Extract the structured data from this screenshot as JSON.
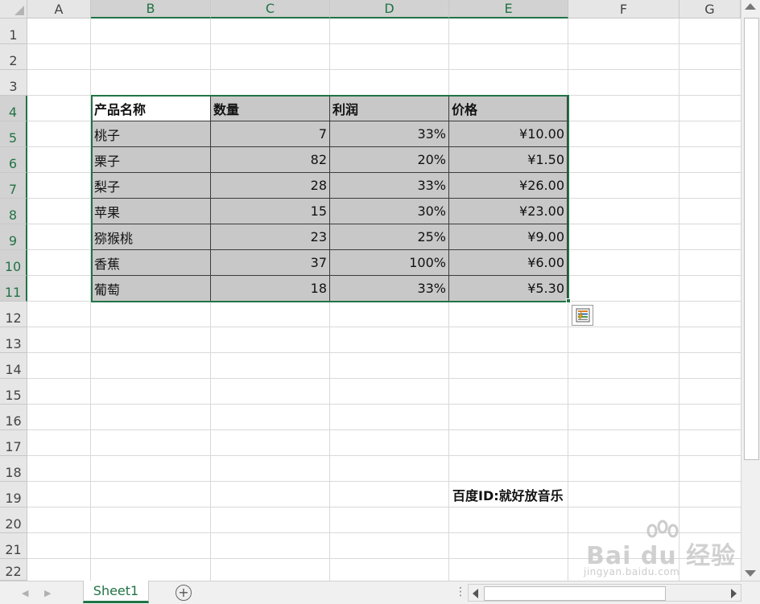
{
  "columns": [
    "A",
    "B",
    "C",
    "D",
    "E",
    "F",
    "G"
  ],
  "rows": [
    "1",
    "2",
    "3",
    "4",
    "5",
    "6",
    "7",
    "8",
    "9",
    "10",
    "11",
    "12",
    "13",
    "14",
    "15",
    "16",
    "17",
    "18",
    "19",
    "20",
    "21",
    "22"
  ],
  "table": {
    "headers": [
      "产品名称",
      "数量",
      "利润",
      "价格"
    ],
    "data": [
      [
        "桃子",
        "7",
        "33%",
        "¥10.00"
      ],
      [
        "栗子",
        "82",
        "20%",
        "¥1.50"
      ],
      [
        "梨子",
        "28",
        "33%",
        "¥26.00"
      ],
      [
        "苹果",
        "15",
        "30%",
        "¥23.00"
      ],
      [
        "猕猴桃",
        "23",
        "25%",
        "¥9.00"
      ],
      [
        "香蕉",
        "37",
        "100%",
        "¥6.00"
      ],
      [
        "葡萄",
        "18",
        "33%",
        "¥5.30"
      ]
    ]
  },
  "note_text": "百度ID:就好放音乐",
  "sheet_tab": "Sheet1",
  "add_sheet_symbol": "+",
  "watermark": {
    "line1": "Bai du 经验",
    "line2": "jingyan.baidu.com"
  },
  "colors": {
    "accent": "#217346",
    "table_fill": "#c8c8c8",
    "header_bg": "#e6e6e6"
  },
  "icons": [
    "quick-analysis-icon",
    "add-sheet-icon",
    "scroll-up-icon",
    "scroll-down-icon",
    "scroll-left-icon",
    "scroll-right-icon"
  ]
}
